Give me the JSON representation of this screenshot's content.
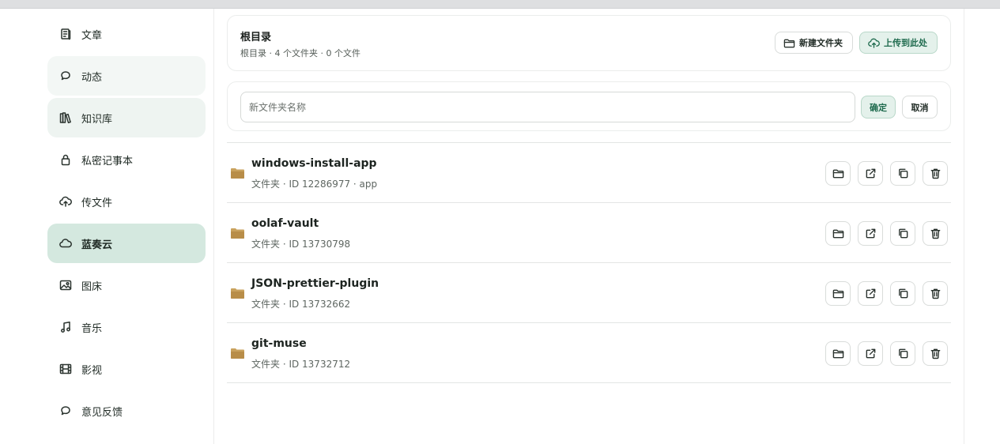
{
  "sidebar": {
    "items": [
      {
        "label": "文章",
        "icon": "article-icon"
      },
      {
        "label": "动态",
        "icon": "chat-bubble-icon"
      },
      {
        "label": "知识库",
        "icon": "books-icon"
      },
      {
        "label": "私密记事本",
        "icon": "lock-icon"
      },
      {
        "label": "传文件",
        "icon": "cloud-upload-icon"
      },
      {
        "label": "蓝奏云",
        "icon": "cloud-icon"
      },
      {
        "label": "图床",
        "icon": "image-icon"
      },
      {
        "label": "音乐",
        "icon": "music-icon"
      },
      {
        "label": "影视",
        "icon": "film-icon"
      },
      {
        "label": "意见反馈",
        "icon": "feedback-icon"
      }
    ],
    "active": "蓝奏云"
  },
  "header": {
    "title": "根目录",
    "subtitle": "根目录 · 4 个文件夹 · 0 个文件",
    "new_folder_label": "新建文件夹",
    "upload_label": "上传到此处"
  },
  "new_folder": {
    "placeholder": "新文件夹名称",
    "confirm_label": "确定",
    "cancel_label": "取消"
  },
  "folders": [
    {
      "name": "windows-install-app",
      "meta": "文件夹 · ID 12286977 · app"
    },
    {
      "name": "oolaf-vault",
      "meta": "文件夹 · ID 13730798"
    },
    {
      "name": "JSON-prettier-plugin",
      "meta": "文件夹 · ID 13732662"
    },
    {
      "name": "git-muse",
      "meta": "文件夹 · ID 13732712"
    }
  ],
  "colors": {
    "accent": "#1f6b4e",
    "active_bg": "#d4e8df",
    "folder": "#c9a25e"
  }
}
